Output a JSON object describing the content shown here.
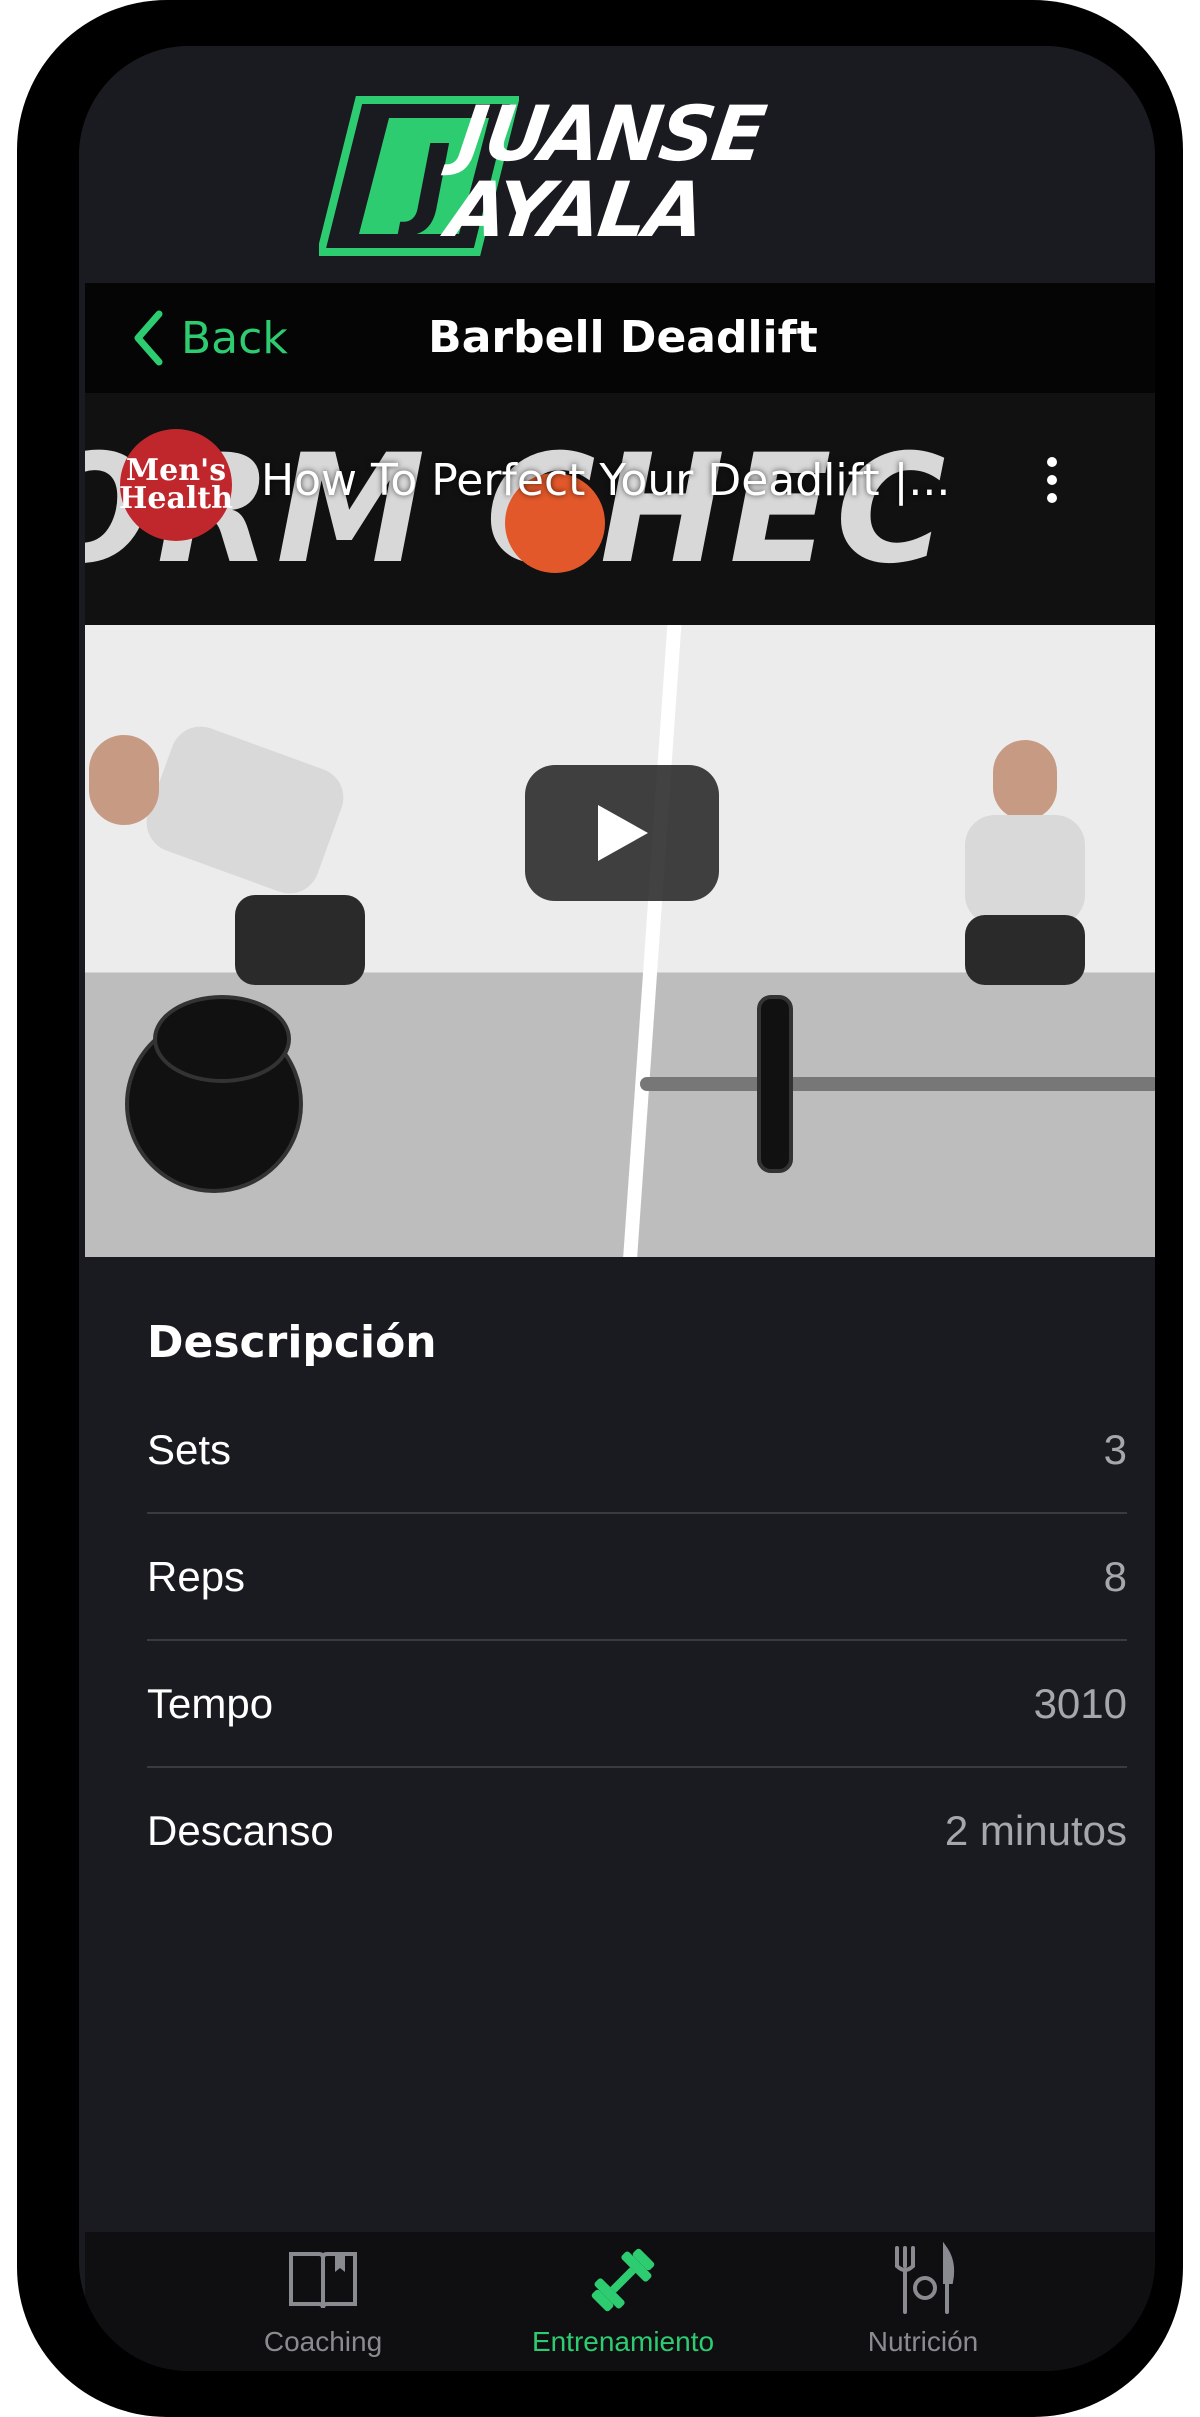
{
  "header": {
    "logo_mark": "J",
    "logo_line1": "JUANSE",
    "logo_line2": "AYALA"
  },
  "nav": {
    "back_label": "Back",
    "title": "Barbell Deadlift"
  },
  "video": {
    "channel_logo": "Men's Health",
    "title": "How To Perfect Your Deadlift |...",
    "banner_text": "ORM  CHEC"
  },
  "description": {
    "title": "Descripción",
    "rows": [
      {
        "label": "Sets",
        "value": "3"
      },
      {
        "label": "Reps",
        "value": "8"
      },
      {
        "label": "Tempo",
        "value": "3010"
      },
      {
        "label": "Descanso",
        "value": "2 minutos"
      }
    ]
  },
  "tabbar": {
    "items": [
      {
        "label": "Coaching",
        "icon": "book-icon",
        "active": false
      },
      {
        "label": "Entrenamiento",
        "icon": "dumbbell-icon",
        "active": true
      },
      {
        "label": "Nutrición",
        "icon": "cutlery-icon",
        "active": false
      }
    ]
  },
  "colors": {
    "accent": "#2ecc71",
    "background": "#1a1b20",
    "muted": "#a6a7ab"
  }
}
